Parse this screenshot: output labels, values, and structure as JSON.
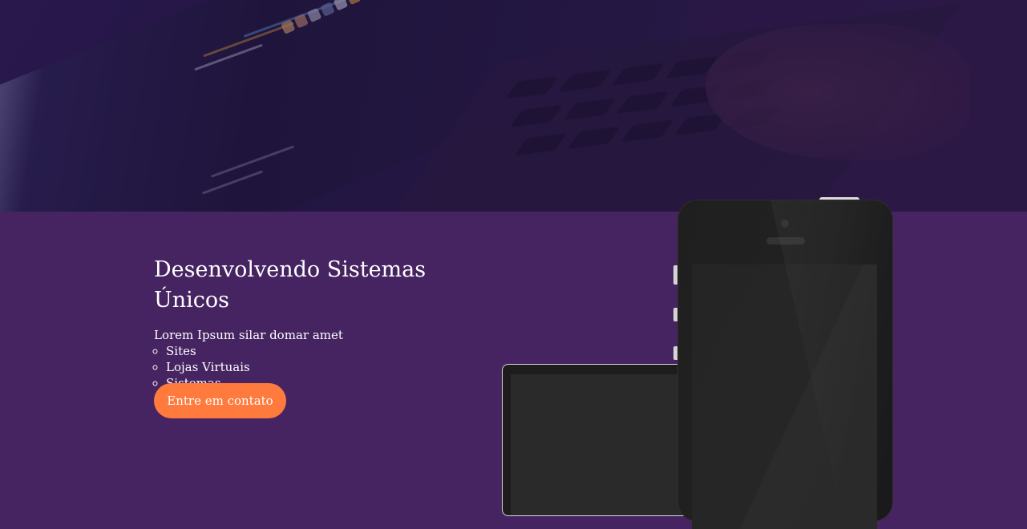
{
  "hero": {
    "image_description_icon": "laptop-code-photo"
  },
  "content": {
    "title": "Desenvolvendo Sistemas Únicos",
    "intro": "Lorem Ipsum silar domar amet",
    "services": [
      {
        "label": "Sites"
      },
      {
        "label": "Lojas Virtuais"
      },
      {
        "label": "Sistemas"
      }
    ],
    "cta_label": "Entre em contato"
  },
  "colors": {
    "background": "#462461",
    "cta": "#ff7a3d",
    "text": "#ffffff"
  }
}
